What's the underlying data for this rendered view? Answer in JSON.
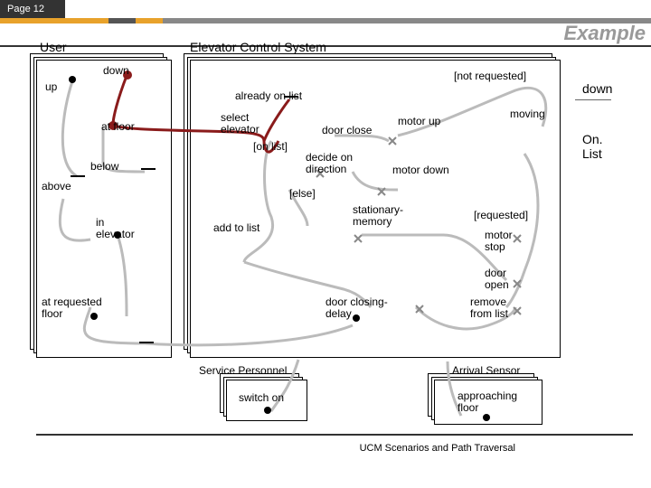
{
  "page_label": "Page 12",
  "slide_title": "Example",
  "user_label": "User",
  "system_label": "Elevator Control System",
  "events": {
    "down": "down",
    "up": "up",
    "at_floor": "at floor",
    "below": "below",
    "above": "above",
    "in_elevator": "in elevator",
    "at_requested_floor": "at requested floor",
    "already_on_list": "already on list",
    "select_elevator": "select elevator",
    "on_list": "[on list]",
    "door_close": "door close",
    "motor_up": "motor up",
    "not_requested": "[not requested]",
    "moving": "moving",
    "decide_on_direction": "decide on direction",
    "motor_down": "motor down",
    "else": "[else]",
    "add_to_list": "add to list",
    "stationary_memory": "stationary- memory",
    "requested": "[requested]",
    "motor_stop": "motor stop",
    "door_open": "door open",
    "remove_from_list": "remove from list",
    "door_closing_delay": "door closing-delay",
    "service_personnel": "Service Personnel",
    "switch_on": "switch on",
    "arrival_sensor": "Arrival Sensor",
    "approaching_floor": "approaching floor"
  },
  "side_labels": {
    "down": "down",
    "on_list": "On. List"
  },
  "footer": "UCM Scenarios and Path Traversal"
}
